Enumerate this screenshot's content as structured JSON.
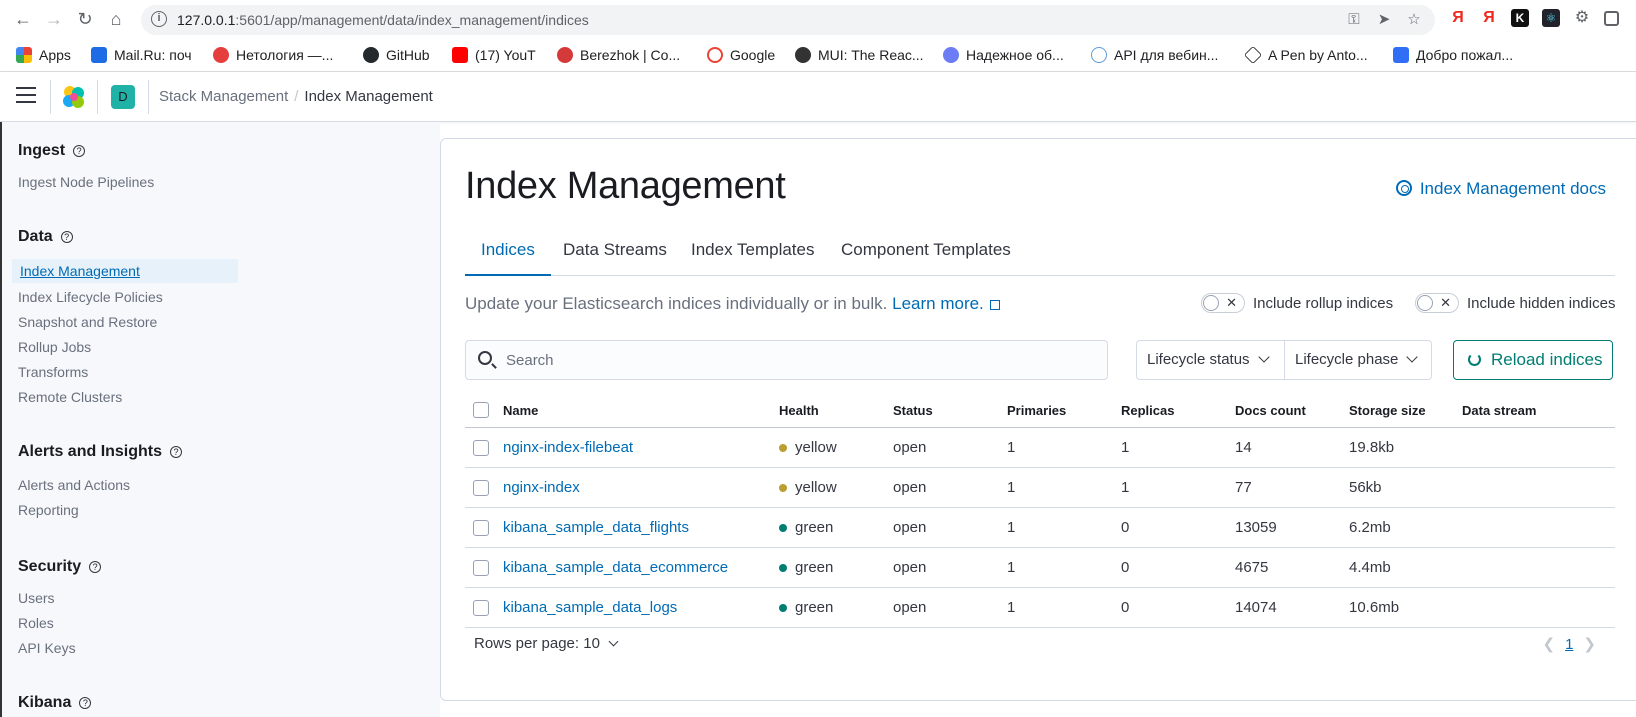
{
  "browser": {
    "url_host": "127.0.0.1",
    "url_rest": ":5601/app/management/data/index_management/indices",
    "bookmarks": [
      {
        "label": "Apps",
        "color": "#4285f4"
      },
      {
        "label": "Mail.Ru: поч",
        "color": "#1e6be6"
      },
      {
        "label": "Нетология —...",
        "color": "#e53e3e"
      },
      {
        "label": "GitHub",
        "color": "#24292e"
      },
      {
        "label": "(17) YouT",
        "color": "#ff0000"
      },
      {
        "label": "Berezhok | Co...",
        "color": "#d53a3a"
      },
      {
        "label": "Google",
        "color": "#ea4335"
      },
      {
        "label": "MUI: The Reac...",
        "color": "#333333"
      },
      {
        "label": "Надежное об...",
        "color": "#6b7cf5"
      },
      {
        "label": "API для вебин...",
        "color": "#5b9bd5"
      },
      {
        "label": "A Pen by Anto...",
        "color": "#222222"
      },
      {
        "label": "Добро пожал...",
        "color": "#2f6ef5"
      }
    ]
  },
  "header": {
    "space_initial": "D",
    "breadcrumb_parent": "Stack Management",
    "breadcrumb_current": "Index Management"
  },
  "sidenav": {
    "groups": [
      {
        "title": "Ingest",
        "items": [
          "Ingest Node Pipelines"
        ]
      },
      {
        "title": "Data",
        "items": [
          "Index Management",
          "Index Lifecycle Policies",
          "Snapshot and Restore",
          "Rollup Jobs",
          "Transforms",
          "Remote Clusters"
        ]
      },
      {
        "title": "Alerts and Insights",
        "items": [
          "Alerts and Actions",
          "Reporting"
        ]
      },
      {
        "title": "Security",
        "items": [
          "Users",
          "Roles",
          "API Keys"
        ]
      },
      {
        "title": "Kibana",
        "items": []
      }
    ]
  },
  "main": {
    "title": "Index Management",
    "docs_link": "Index Management docs",
    "tabs": [
      "Indices",
      "Data Streams",
      "Index Templates",
      "Component Templates"
    ],
    "description": "Update your Elasticsearch indices individually or in bulk.",
    "learn_more": "Learn more.",
    "toggle_rollup": "Include rollup indices",
    "toggle_hidden": "Include hidden indices",
    "search_placeholder": "Search",
    "filter_lifecycle_status": "Lifecycle status",
    "filter_lifecycle_phase": "Lifecycle phase",
    "reload_label": "Reload indices",
    "columns": [
      "Name",
      "Health",
      "Status",
      "Primaries",
      "Replicas",
      "Docs count",
      "Storage size",
      "Data stream"
    ],
    "rows": [
      {
        "name": "nginx-index-filebeat",
        "health": "yellow",
        "status": "open",
        "primaries": "1",
        "replicas": "1",
        "docs": "14",
        "size": "19.8kb",
        "stream": ""
      },
      {
        "name": "nginx-index",
        "health": "yellow",
        "status": "open",
        "primaries": "1",
        "replicas": "1",
        "docs": "77",
        "size": "56kb",
        "stream": ""
      },
      {
        "name": "kibana_sample_data_flights",
        "health": "green",
        "status": "open",
        "primaries": "1",
        "replicas": "0",
        "docs": "13059",
        "size": "6.2mb",
        "stream": ""
      },
      {
        "name": "kibana_sample_data_ecommerce",
        "health": "green",
        "status": "open",
        "primaries": "1",
        "replicas": "0",
        "docs": "4675",
        "size": "4.4mb",
        "stream": ""
      },
      {
        "name": "kibana_sample_data_logs",
        "health": "green",
        "status": "open",
        "primaries": "1",
        "replicas": "0",
        "docs": "14074",
        "size": "10.6mb",
        "stream": ""
      }
    ],
    "rows_per_page": "Rows per page: 10",
    "current_page": "1",
    "health_colors": {
      "yellow": "#b9a031",
      "green": "#017d73"
    }
  }
}
